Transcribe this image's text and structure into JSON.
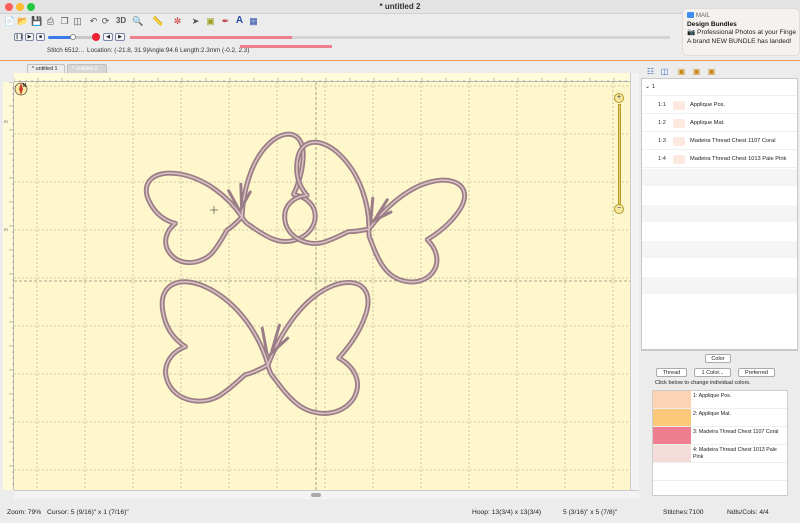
{
  "window": {
    "title": "* untitled 2",
    "traffic_lights": [
      "#fe5f57",
      "#febc2e",
      "#28c840"
    ]
  },
  "toolbar": {
    "icons": [
      "new-file-icon",
      "open-folder-icon",
      "save-icon",
      "print-icon",
      "copy-icon",
      "paste-icon",
      "undo-redo-icon",
      "rotate-icon",
      "view-3d-icon",
      "zoom-icon",
      "ruler-icon",
      "wand-icon",
      "hoop-icon",
      "pointer-icon",
      "design-icon",
      "paint-icon",
      "text-icon",
      "export-icon"
    ],
    "label_3d": "3D",
    "label_text": "A"
  },
  "playback": {
    "stitch_speed": 0.55,
    "progress": 0.3
  },
  "info": {
    "stitch": "Stitch 6512…",
    "location": "Location: (-21.8, 31.9)",
    "angle": "Angle:94.6",
    "length": "Length:2.3mm",
    "offset": "(-0.2, 2.3)"
  },
  "notification": {
    "app": "MAIL",
    "title": "Design Bundles",
    "line1": "📷 Professional Photos at your Finge",
    "line2": "A brand NEW BUNDLE has landed!"
  },
  "tabs": [
    {
      "label": "* untitled 1",
      "active": false
    },
    {
      "label": "* untitled 2",
      "active": true
    }
  ],
  "rulers": {
    "left_marks": [
      "",
      "m",
      "",
      "",
      "",
      "m",
      "",
      "",
      "",
      "",
      "",
      "",
      "",
      "",
      ""
    ]
  },
  "sequence": {
    "group": "1",
    "items": [
      {
        "index": "1:1",
        "name": "Applique Pos."
      },
      {
        "index": "1:2",
        "name": "Applique Mat."
      },
      {
        "index": "1:3",
        "name": "Madeira Thread Chest 1107 Coral"
      },
      {
        "index": "1:4",
        "name": "Madeira Thread Chest 1013 Pale Pink"
      }
    ]
  },
  "color_panel": {
    "header": "Color",
    "thread_btn": "Thread",
    "color_btn": "1 Color...",
    "preferred_btn": "Preferred",
    "hint": "Click below to change individual colors.",
    "colors": [
      {
        "label": "1: Applique Pos.",
        "hex": "#fcd4b4"
      },
      {
        "label": "2: Applique Mat.",
        "hex": "#fcc87a"
      },
      {
        "label": "3: Madeira Thread Chest 1107 Coral",
        "hex": "#ef7f8e"
      },
      {
        "label": "4: Madeira Thread Chest 1013 Pale Pink",
        "hex": "#f4ddd9"
      }
    ]
  },
  "status": {
    "zoom": "Zoom: 79%",
    "cursor": "Cursor: 5 (9/16)\" x 1 (7/16)\"",
    "hoop": "Hoop: 13(3/4) x 13(3/4)",
    "size": "5 (3/16)\" x 5 (7/8)\"",
    "stitches": "Stitches:7100",
    "ndls": "Ndls/Cols: 4/4"
  }
}
